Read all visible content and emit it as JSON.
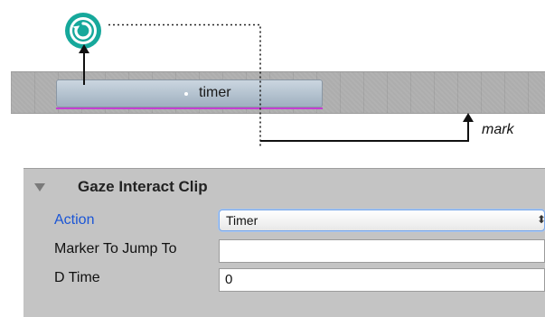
{
  "timeline": {
    "clip_label": "timer",
    "mark_label": "mark"
  },
  "icons": {
    "refresh": "refresh-icon",
    "arrow": "arrow-up-icon",
    "collapse": "triangle-down-icon"
  },
  "colors": {
    "refresh_icon": "#16a89b",
    "clip_underline": "#c43fd2",
    "action_label": "#1a55d6"
  },
  "inspector": {
    "title": "Gaze Interact Clip",
    "fields": [
      {
        "label": "Action",
        "value": "Timer"
      },
      {
        "label": "Marker To Jump To",
        "value": ""
      },
      {
        "label": "D Time",
        "value": "0"
      }
    ]
  }
}
